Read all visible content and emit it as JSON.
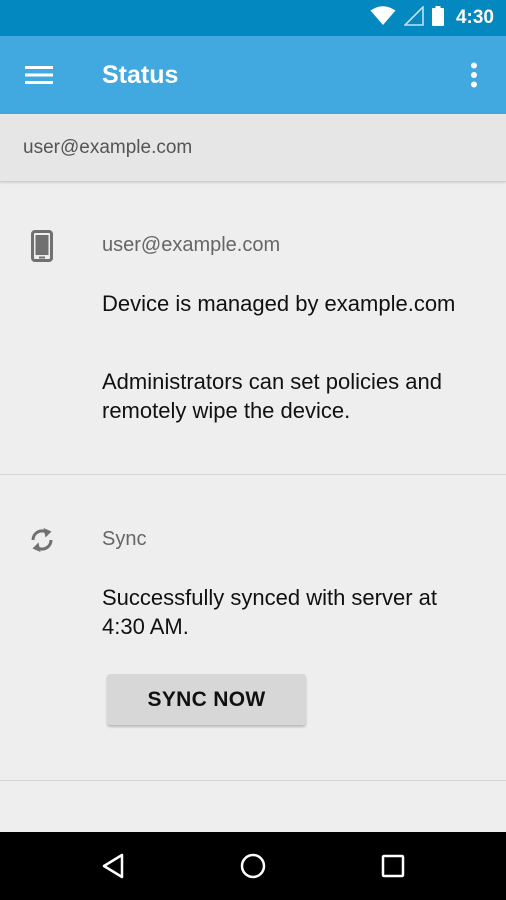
{
  "status_bar": {
    "time": "4:30",
    "icons": [
      "wifi-icon",
      "signal-icon",
      "battery-icon"
    ]
  },
  "app_bar": {
    "title": "Status",
    "menu_icon": "hamburger-menu-icon",
    "overflow_icon": "more-vert-icon"
  },
  "account": {
    "email": "user@example.com"
  },
  "device_card": {
    "icon": "phone-icon",
    "label": "user@example.com",
    "managed_text": "Device is managed by example.com",
    "admin_text": "Administrators can set policies and remotely wipe the device."
  },
  "sync_card": {
    "icon": "sync-icon",
    "label": "Sync",
    "status_text": "Successfully synced with server at 4:30 AM.",
    "button_label": "SYNC NOW"
  },
  "nav_bar": {
    "icons": [
      "back-icon",
      "home-icon",
      "recents-icon"
    ]
  },
  "colors": {
    "status_bar": "#0388bf",
    "app_bar": "#42a9e0",
    "background": "#eeeeee"
  }
}
